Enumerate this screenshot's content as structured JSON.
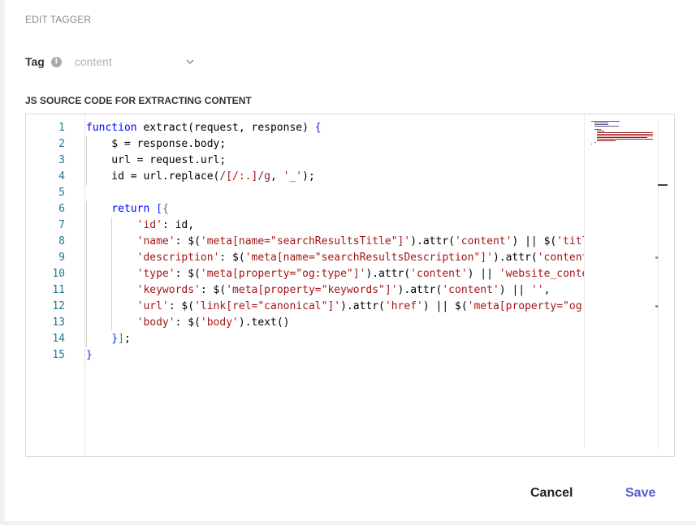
{
  "dialog": {
    "title": "EDIT TAGGER"
  },
  "tag": {
    "label": "Tag",
    "info_icon": "i",
    "value": "content"
  },
  "source": {
    "label": "JS SOURCE CODE FOR EXTRACTING CONTENT"
  },
  "editor": {
    "line_numbers": [
      "1",
      "2",
      "3",
      "4",
      "5",
      "6",
      "7",
      "8",
      "9",
      "10",
      "11",
      "12",
      "13",
      "14",
      "15"
    ],
    "lines": [
      "function extract(request, response) {",
      "    $ = response.body;",
      "    url = request.url;",
      "    id = url.replace(/[/:.]/g, '_');",
      "",
      "    return [{",
      "        'id': id,",
      "        'name': $('meta[name=\"searchResultsTitle\"]').attr('content') || $('title",
      "        'description': $('meta[name=\"searchResultsDescription\"]').attr('content'",
      "        'type': $('meta[property=\"og:type\"]').attr('content') || 'website_conten",
      "        'keywords': $('meta[property=\"keywords\"]').attr('content') || '',",
      "        'url': $('link[rel=\"canonical\"]').attr('href') || $('meta[property=\"og:u",
      "        'body': $('body').text()",
      "    }];",
      "}"
    ]
  },
  "actions": {
    "cancel_label": "Cancel",
    "save_label": "Save"
  },
  "colors": {
    "accent": "#5b5bd6",
    "keyword": "#0000ff",
    "string": "#a31515",
    "line_number": "#237893"
  },
  "icons": {
    "info": "info-icon",
    "dropdown": "chevron-down-icon"
  }
}
